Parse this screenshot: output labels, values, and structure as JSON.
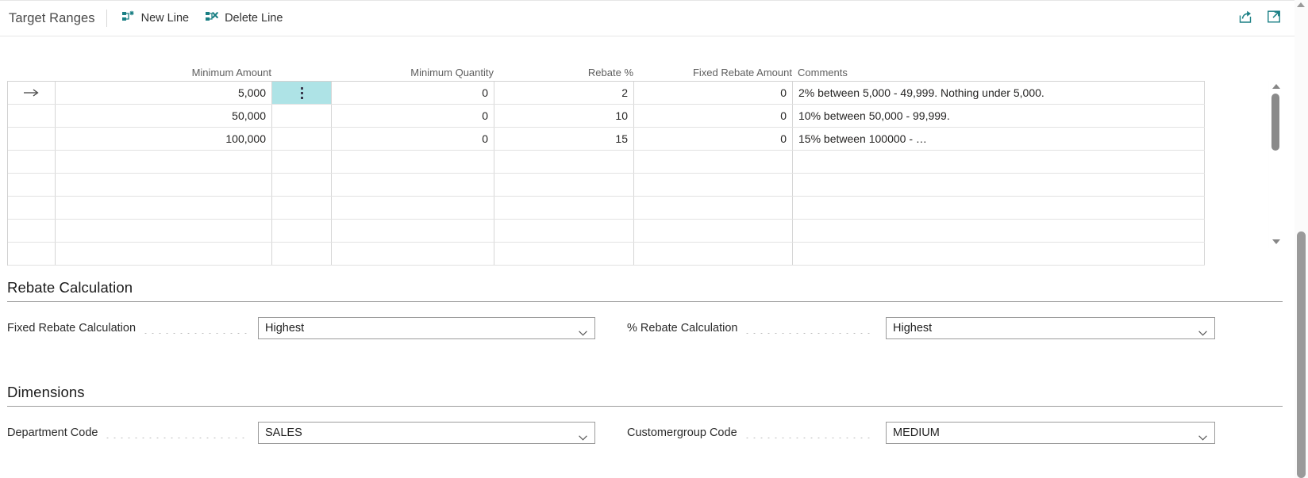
{
  "toolbar": {
    "title": "Target Ranges",
    "actions": [
      {
        "label": "New Line",
        "icon": "new-line-icon"
      },
      {
        "label": "Delete Line",
        "icon": "delete-line-icon"
      }
    ],
    "right_icons": [
      {
        "icon": "share-icon"
      },
      {
        "icon": "open-in-new-window-icon"
      }
    ]
  },
  "grid": {
    "columns": [
      {
        "key": "indicator",
        "label": ""
      },
      {
        "key": "minimum_amount",
        "label": "Minimum Amount",
        "align": "right"
      },
      {
        "key": "selector",
        "label": ""
      },
      {
        "key": "minimum_quantity",
        "label": "Minimum Quantity",
        "align": "right"
      },
      {
        "key": "rebate_pct",
        "label": "Rebate %",
        "align": "right"
      },
      {
        "key": "fixed_rebate_amount",
        "label": "Fixed Rebate Amount",
        "align": "right"
      },
      {
        "key": "comments",
        "label": "Comments",
        "align": "left"
      }
    ],
    "rows": [
      {
        "indicator": "→",
        "minimum_amount": "5,000",
        "selected": true,
        "minimum_quantity": "0",
        "rebate_pct": "2",
        "fixed_rebate_amount": "0",
        "comments": "2% between 5,000 - 49,999. Nothing under 5,000."
      },
      {
        "indicator": "",
        "minimum_amount": "50,000",
        "selected": false,
        "minimum_quantity": "0",
        "rebate_pct": "10",
        "fixed_rebate_amount": "0",
        "comments": "10% between 50,000 - 99,999."
      },
      {
        "indicator": "",
        "minimum_amount": "100,000",
        "selected": false,
        "minimum_quantity": "0",
        "rebate_pct": "15",
        "fixed_rebate_amount": "0",
        "comments": "15% between 100000 - …"
      },
      {
        "indicator": "",
        "minimum_amount": "",
        "selected": false,
        "minimum_quantity": "",
        "rebate_pct": "",
        "fixed_rebate_amount": "",
        "comments": ""
      },
      {
        "indicator": "",
        "minimum_amount": "",
        "selected": false,
        "minimum_quantity": "",
        "rebate_pct": "",
        "fixed_rebate_amount": "",
        "comments": ""
      },
      {
        "indicator": "",
        "minimum_amount": "",
        "selected": false,
        "minimum_quantity": "",
        "rebate_pct": "",
        "fixed_rebate_amount": "",
        "comments": ""
      },
      {
        "indicator": "",
        "minimum_amount": "",
        "selected": false,
        "minimum_quantity": "",
        "rebate_pct": "",
        "fixed_rebate_amount": "",
        "comments": ""
      },
      {
        "indicator": "",
        "minimum_amount": "",
        "selected": false,
        "minimum_quantity": "",
        "rebate_pct": "",
        "fixed_rebate_amount": "",
        "comments": ""
      }
    ],
    "scrollbar": {
      "up_icon": "scroll-up-arrow-icon",
      "down_icon": "scroll-down-arrow-icon"
    }
  },
  "sections": [
    {
      "title": "Rebate Calculation",
      "fields": [
        {
          "label": "Fixed Rebate Calculation",
          "value": "Highest"
        },
        {
          "label": "% Rebate Calculation",
          "value": "Highest"
        }
      ]
    },
    {
      "title": "Dimensions",
      "fields": [
        {
          "label": "Department Code",
          "value": "SALES"
        },
        {
          "label": "Customergroup Code",
          "value": "MEDIUM"
        }
      ]
    }
  ],
  "colors": {
    "accent_teal": "#1a7f84",
    "selected_cell": "#aee3e6",
    "text_primary": "#252423",
    "grid_line": "#d6d6d6"
  }
}
